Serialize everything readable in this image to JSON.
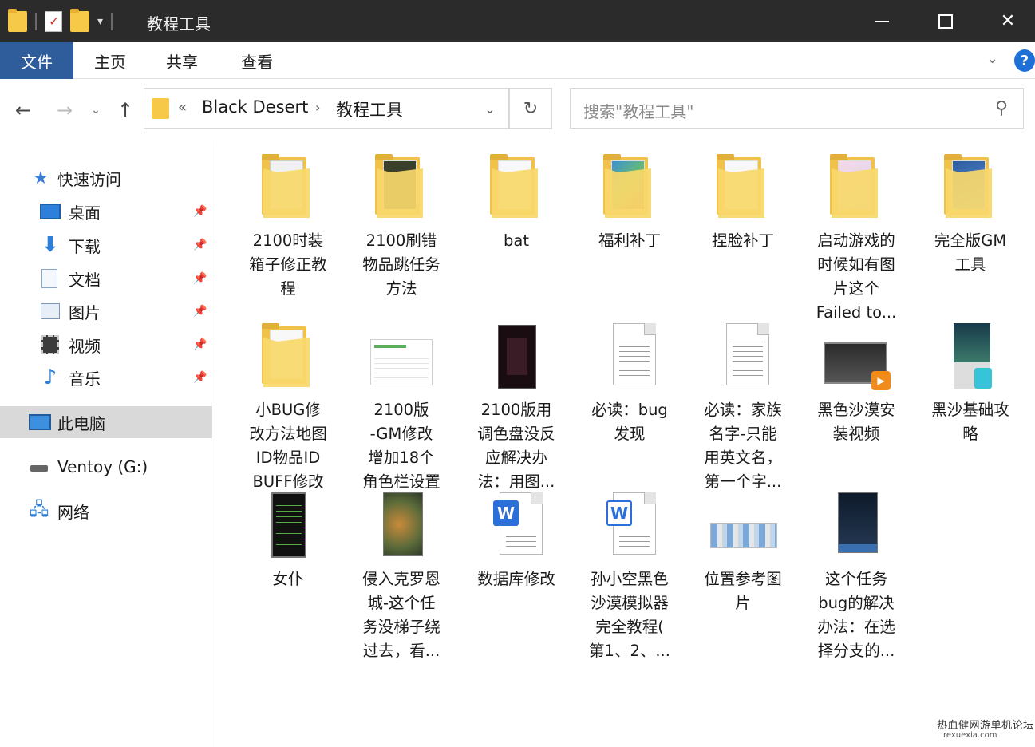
{
  "window": {
    "title": "教程工具"
  },
  "ribbon": {
    "tabs": [
      "文件",
      "主页",
      "共享",
      "查看"
    ],
    "help": "?"
  },
  "address": {
    "overflow": "«",
    "crumbs": [
      "Black Desert",
      "教程工具"
    ],
    "separator": "›",
    "refresh_glyph": "↻"
  },
  "search": {
    "placeholder": "搜索\"教程工具\""
  },
  "sidebar": {
    "quick_access": "快速访问",
    "pinned": [
      {
        "label": "桌面",
        "icon": "desktop-icon"
      },
      {
        "label": "下载",
        "icon": "download-icon"
      },
      {
        "label": "文档",
        "icon": "documents-icon"
      },
      {
        "label": "图片",
        "icon": "pictures-icon"
      },
      {
        "label": "视频",
        "icon": "videos-icon"
      },
      {
        "label": "音乐",
        "icon": "music-icon"
      }
    ],
    "this_pc": "此电脑",
    "drive": "Ventoy (G:)",
    "network": "网络"
  },
  "files": [
    {
      "name": "2100时装箱子修正教程",
      "lines": [
        "2100时装",
        "箱子修正教",
        "程"
      ],
      "type": "folder"
    },
    {
      "name": "2100刷错物品跳任务方法",
      "lines": [
        "2100刷错",
        "物品跳任务",
        "方法"
      ],
      "type": "folder"
    },
    {
      "name": "bat",
      "lines": [
        "bat"
      ],
      "type": "folder"
    },
    {
      "name": "福利补丁",
      "lines": [
        "福利补丁"
      ],
      "type": "folder"
    },
    {
      "name": "捏脸补丁",
      "lines": [
        "捏脸补丁"
      ],
      "type": "folder"
    },
    {
      "name": "启动游戏的时候如有图片这个Failed to...",
      "lines": [
        "启动游戏的",
        "时候如有图",
        "片这个",
        "Failed to..."
      ],
      "type": "folder"
    },
    {
      "name": "完全版GM工具",
      "lines": [
        "完全版GM",
        "工具"
      ],
      "type": "folder"
    },
    {
      "name": "小BUG修改方法地图ID物品IDBUFF修改",
      "lines": [
        "小BUG修",
        "改方法地图",
        "ID物品ID",
        "BUFF修改"
      ],
      "type": "folder"
    },
    {
      "name": "2100版-GM修改增加18个角色栏设置",
      "lines": [
        "2100版",
        "-GM修改",
        "增加18个",
        "角色栏设置"
      ],
      "type": "image"
    },
    {
      "name": "2100版用调色盘没反应解决办法：用图...",
      "lines": [
        "2100版用",
        "调色盘没反",
        "应解决办",
        "法：用图..."
      ],
      "type": "image"
    },
    {
      "name": "必读：bug发现",
      "lines": [
        "必读：bug",
        "发现"
      ],
      "type": "text"
    },
    {
      "name": "必读：家族名字-只能用英文名，第一个字...",
      "lines": [
        "必读：家族",
        "名字-只能",
        "用英文名，",
        "第一个字..."
      ],
      "type": "text"
    },
    {
      "name": "黑色沙漠安装视频",
      "lines": [
        "黑色沙漠安",
        "装视频"
      ],
      "type": "video"
    },
    {
      "name": "黑沙基础攻略",
      "lines": [
        "黑沙基础攻",
        "略"
      ],
      "type": "image"
    },
    {
      "name": "女仆",
      "lines": [
        "女仆"
      ],
      "type": "image"
    },
    {
      "name": "侵入克罗恩城-这个任务没梯子绕过去，看...",
      "lines": [
        "侵入克罗恩",
        "城-这个任",
        "务没梯子绕",
        "过去，看..."
      ],
      "type": "image"
    },
    {
      "name": "数据库修改",
      "lines": [
        "数据库修改"
      ],
      "type": "word"
    },
    {
      "name": "孙小空黑色沙漠模拟器完全教程(第1、2、...",
      "lines": [
        "孙小空黑色",
        "沙漠模拟器",
        "完全教程(",
        "第1、2、..."
      ],
      "type": "word"
    },
    {
      "name": "位置参考图片",
      "lines": [
        "位置参考图",
        "片"
      ],
      "type": "image"
    },
    {
      "name": "这个任务bug的解决办法：在选择分支的...",
      "lines": [
        "这个任务",
        "bug的解决",
        "办法：在选",
        "择分支的..."
      ],
      "type": "image"
    }
  ],
  "watermark": {
    "text": "热血健网游单机论坛",
    "sub": "rexuexia.com"
  }
}
